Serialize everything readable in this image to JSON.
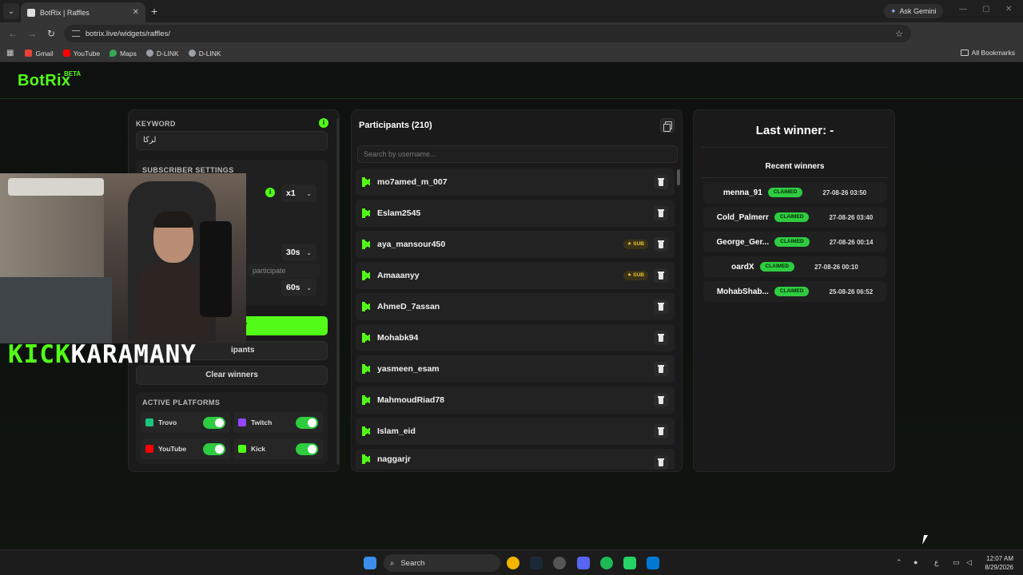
{
  "browser": {
    "tab_title": "BotRix | Raffles",
    "new_tab_symbol": "+",
    "close_symbol": "✕",
    "ask_gemini": "Ask Gemini",
    "url": "botrix.live/widgets/raffles/",
    "bookmarks": [
      {
        "label": "Gmail",
        "icon": "gmail-icon",
        "color": "#ea4335"
      },
      {
        "label": "YouTube",
        "icon": "youtube-icon",
        "color": "#ff0000"
      },
      {
        "label": "Maps",
        "icon": "maps-icon",
        "color": "#34a853"
      },
      {
        "label": "D-LINK",
        "icon": "globe-icon",
        "color": "#9aa0a6"
      },
      {
        "label": "D-LINK",
        "icon": "globe-icon",
        "color": "#9aa0a6"
      }
    ],
    "all_bookmarks": "All Bookmarks"
  },
  "app": {
    "logo": "BotRix",
    "beta": "BETA",
    "accent_color": "#53fc18"
  },
  "settings": {
    "keyword_label": "KEYWORD",
    "keyword_value": "لركا",
    "subscriber_label": "SUBSCRIBER SETTINGS",
    "multiplier": "x1",
    "participate_hint": "participate",
    "time_1": "30s",
    "time_2": "60s",
    "green_button": "er",
    "participants_button": "ipants",
    "clear_winners": "Clear winners",
    "active_platforms_label": "ACTIVE PLATFORMS",
    "platforms": [
      {
        "name": "Trovo",
        "icon": "trovo-icon",
        "color": "#1bc47d",
        "enabled": true
      },
      {
        "name": "Twitch",
        "icon": "twitch-icon",
        "color": "#9146ff",
        "enabled": true
      },
      {
        "name": "YouTube",
        "icon": "youtube-icon",
        "color": "#ff0000",
        "enabled": true
      },
      {
        "name": "Kick",
        "icon": "kick-icon",
        "color": "#53fc18",
        "enabled": true
      }
    ]
  },
  "overlay": {
    "brand_kick": "KICK",
    "brand_name": "KARAMANY"
  },
  "participants": {
    "title": "Participants (210)",
    "search_placeholder": "Search by username...",
    "sub_badge": "★ SUB",
    "items": [
      {
        "name": "mo7amed_m_007",
        "sub": false
      },
      {
        "name": "Eslam2545",
        "sub": false
      },
      {
        "name": "aya_mansour450",
        "sub": true
      },
      {
        "name": "Amaaanyy",
        "sub": true
      },
      {
        "name": "AhmeD_7assan",
        "sub": false
      },
      {
        "name": "Mohabk94",
        "sub": false
      },
      {
        "name": "yasmeen_esam",
        "sub": false
      },
      {
        "name": "MahmoudRiad78",
        "sub": false
      },
      {
        "name": "Islam_eid",
        "sub": false
      },
      {
        "name": "naggarjr",
        "sub": false
      }
    ]
  },
  "winners": {
    "last_winner": "Last winner: -",
    "recent_title": "Recent winners",
    "claimed_label": "CLAIMED",
    "items": [
      {
        "name": "menna_91",
        "date": "27-08-26 03:50"
      },
      {
        "name": "Cold_Palmerr",
        "date": "27-08-26 03:40"
      },
      {
        "name": "George_Ger...",
        "date": "27-08-26 00:14"
      },
      {
        "name": "oardX",
        "date": "27-08-26 00:10"
      },
      {
        "name": "MohabShab...",
        "date": "25-08-26 06:52"
      }
    ]
  },
  "taskbar": {
    "search": "Search",
    "time": "12:07 AM",
    "date": "8/29/2026",
    "lang": "ع"
  }
}
